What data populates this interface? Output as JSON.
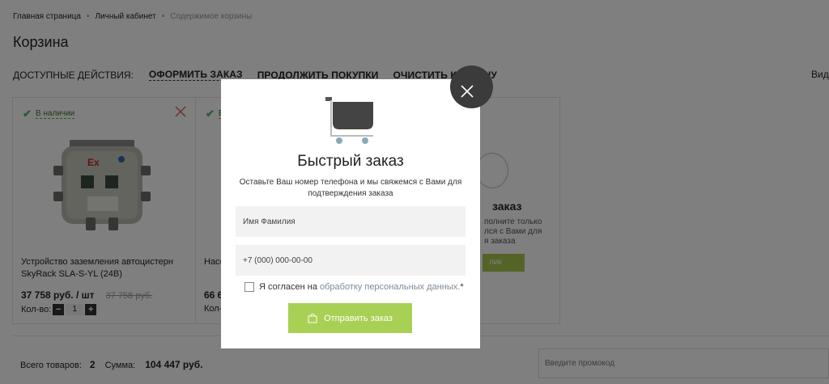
{
  "breadcrumb": {
    "home": "Главная страница",
    "account": "Личный кабинет",
    "current": "Содержимое корзины"
  },
  "page_title": "Корзина",
  "actions": {
    "label": "ДОСТУПНЫЕ ДЕЙСТВИЯ:",
    "checkout": "ОФОРМИТЬ ЗАКАЗ",
    "continue": "ПРОДОЛЖИТЬ ПОКУПКИ",
    "clear": "ОЧИСТИТЬ КОРЗИНУ",
    "view": "Вид"
  },
  "cards": [
    {
      "stock": "В наличии",
      "name": "Устройство заземления автоцистерн SkyRack SLA-S-YL (24В)",
      "price": "37 758 руб. / шт",
      "old_price": "37 758 руб.",
      "qty_label": "Кол-во:",
      "qty": "1",
      "minus": "−",
      "plus": "+"
    },
    {
      "stock": "В",
      "name": "Насо",
      "price": "66 6",
      "qty_label": "Кол-"
    }
  ],
  "quick_card": {
    "title": "заказ",
    "text": "полните только\nлся с Вами для\nя заказа",
    "button": "лик"
  },
  "summary": {
    "total_label": "Всего товаров:",
    "total_value": "2",
    "sum_label": "Сумма:",
    "sum_value": "104 447 руб.",
    "promo_placeholder": "Введите промокод"
  },
  "modal": {
    "title": "Быстрый заказ",
    "description": "Оставьте Ваш номер телефона и мы свяжемся с Вами для подтверждения заказа",
    "name_placeholder": "Имя Фамилия",
    "phone_placeholder": "+7 (000) 000-00-00",
    "agree_text": "Я согласен на",
    "agree_link": "обработку персональных данных.",
    "agree_star": "*",
    "submit": "Отправить заказ"
  },
  "colors": {
    "accent_green": "#a8d054",
    "stock_green": "#5cb85c",
    "close_bg": "#3b3b3b",
    "remove_red": "#e06060"
  }
}
